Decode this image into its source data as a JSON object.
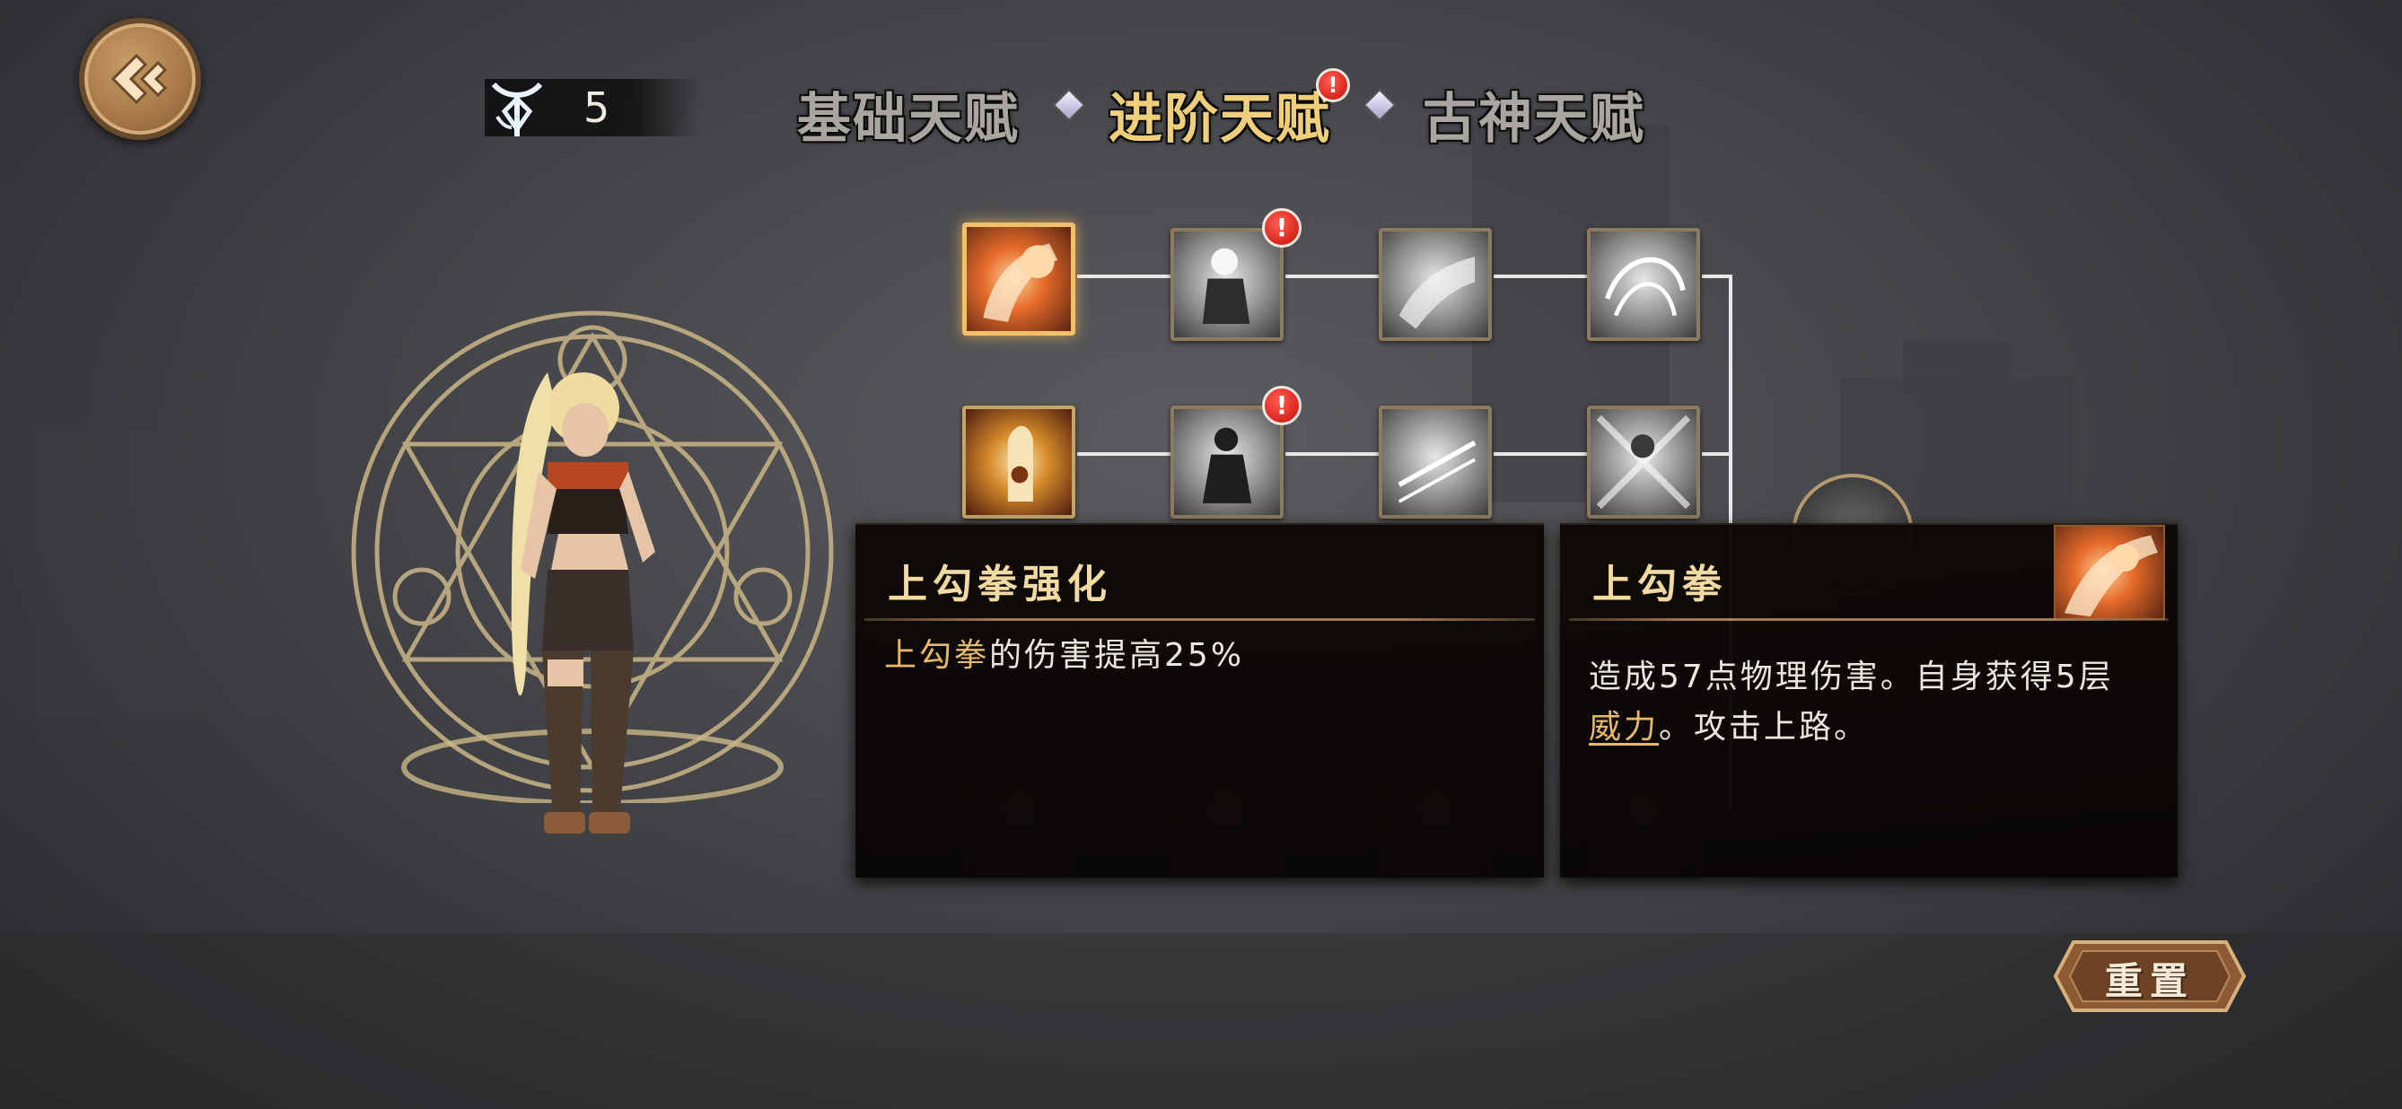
{
  "points": {
    "value": "5",
    "icon": "talent-point-rune-icon"
  },
  "tabs": [
    {
      "label": "基础天赋",
      "state": "inactive"
    },
    {
      "label": "进阶天赋",
      "state": "active",
      "alert": "!"
    },
    {
      "label": "古神天赋",
      "state": "inactive"
    }
  ],
  "alerts": {
    "mark": "!"
  },
  "tooltip_left": {
    "title": "上勾拳强化",
    "desc_highlight": "上勾拳",
    "desc_rest": "的伤害提高25%"
  },
  "tooltip_right": {
    "title": "上勾拳",
    "desc_part1": "造成57点物理伤害。自身获得5层",
    "desc_keyword": "威力",
    "desc_part2": "。攻击上路。"
  },
  "reset_button": {
    "label": "重置"
  },
  "colors": {
    "accent_gold": "#f0cf7a",
    "highlight_text": "#e8b96c",
    "alert_red": "#d8261c"
  }
}
